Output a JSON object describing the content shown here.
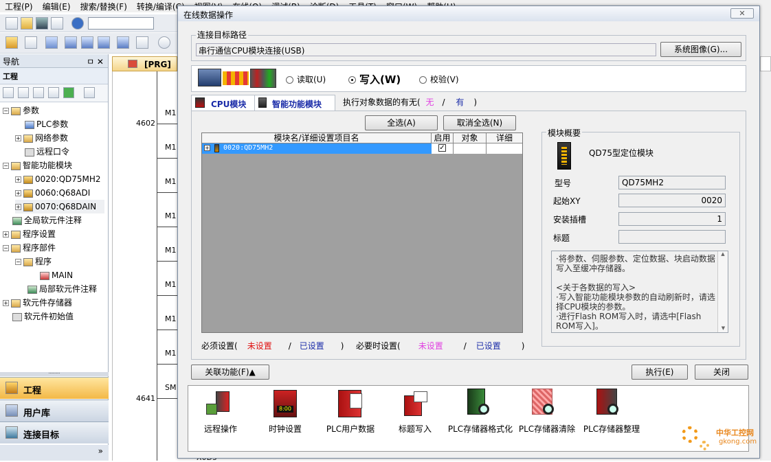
{
  "menu": [
    "工程(P)",
    "编辑(E)",
    "搜索/替换(F)",
    "转换/编译(C)",
    "视图(V)",
    "在线(O)",
    "调试(B)",
    "诊断(D)",
    "工具(T)",
    "窗口(W)",
    "帮助(H)"
  ],
  "nav": {
    "title": "导航",
    "pin": "ㅁ ✕",
    "section": "工程",
    "tree": [
      "参数",
      "PLC参数",
      "网络参数",
      "远程口令",
      "智能功能模块",
      "0020:QD75MH2",
      "0060:Q68ADI",
      "0070:Q68DAIN",
      "全局软元件注释",
      "程序设置",
      "程序部件",
      "程序",
      "MAIN",
      "局部软元件注释",
      "软元件存储器",
      "软元件初始值"
    ],
    "bottom": [
      "工程",
      "用户库",
      "连接目标"
    ],
    "more": "»"
  },
  "tab": {
    "label": "[PRG]写"
  },
  "ladder": {
    "step1": "4602",
    "step2": "4641",
    "contacts": [
      "M1",
      "M1",
      "M1",
      "M1",
      "M1",
      "M1",
      "M1",
      "M1",
      "SM"
    ],
    "bottom": "X0D5"
  },
  "dialog": {
    "title": "在线数据操作",
    "close": "✕",
    "conn_group": "连接目标路径",
    "conn_path": "串行通信CPU模块连接(USB)",
    "sys_image": "系统图像(G)...",
    "modes": {
      "read": "读取(U)",
      "write": "写入(W)",
      "verify": "校验(V)",
      "selected": "write"
    },
    "tabs": {
      "cpu": "CPU模块",
      "intelli": "智能功能模块"
    },
    "exist": {
      "prefix": "执行对象数据的有无(",
      "none": "无",
      "sep": "/",
      "yes": "有",
      "suffix": ")"
    },
    "select_all": "全选(A)",
    "deselect_all": "取消全选(N)",
    "table": {
      "headers": [
        "模块名/详细设置项目名",
        "启用",
        "对象",
        "详细"
      ],
      "rows": [
        {
          "name": "0020:QD75MH2",
          "enabled": true
        }
      ]
    },
    "legend": {
      "required": "必须设置(",
      "req_unset": "未设置",
      "sep": "/",
      "req_set": "已设置",
      "close1": ")",
      "optional": "必要时设置(",
      "opt_unset": "未设置",
      "opt_set": "已设置",
      "close2": ")"
    },
    "overview": {
      "title": "模块概要",
      "module": "QD75型定位模块",
      "labels": {
        "model": "型号",
        "startxy": "起始XY",
        "slot": "安装插槽",
        "caption": "标题"
      },
      "values": {
        "model": "QD75MH2",
        "startxy": "0020",
        "slot": "1",
        "caption": ""
      },
      "desc": [
        "·将参数、伺服参数、定位数据、块启动数据写入至缓冲存储器。",
        "",
        "<关于各数据的写入>",
        "·写入智能功能模块参数的自动刷新时，请选择CPU模块的参数。",
        "·进行Flash ROM写入时，请选中[Flash ROM写入]。"
      ]
    },
    "related": "关联功能(F)▲",
    "execute": "执行(E)",
    "close_btn": "关闭",
    "funcs": [
      "远程操作",
      "时钟设置",
      "PLC用户数据",
      "标题写入",
      "PLC存储器格式化",
      "PLC存储器清除",
      "PLC存储器整理"
    ],
    "clock": "8:00"
  },
  "watermark": {
    "brand": "中华工控网",
    "url": "gkong.com"
  }
}
